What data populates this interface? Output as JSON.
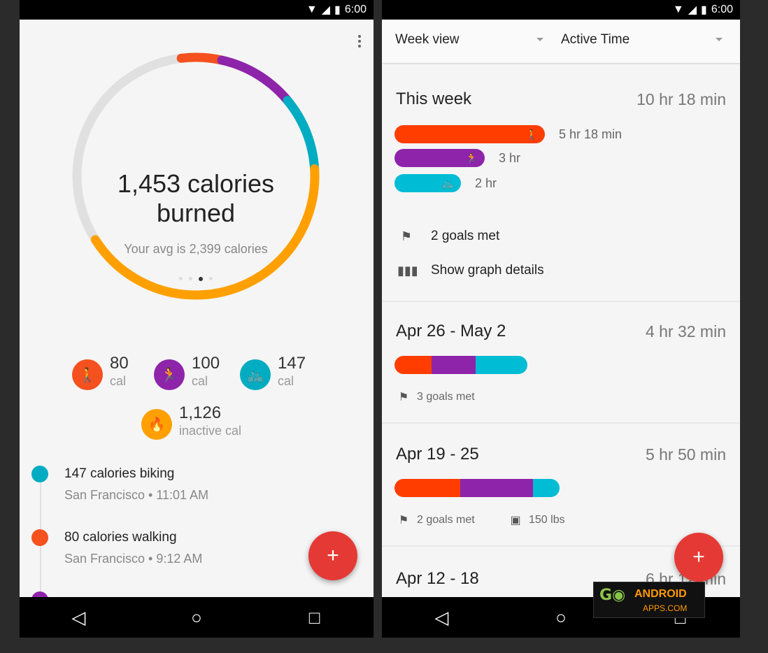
{
  "left": {
    "status_time": "6:00",
    "summary": {
      "calories_line1": "1,453 calories",
      "calories_line2": "burned",
      "avg": "Your avg is 2,399 calories"
    },
    "ring": {
      "segments": [
        {
          "name": "walking",
          "color": "#f4511e",
          "fraction": 0.055
        },
        {
          "name": "running",
          "color": "#8e24aa",
          "fraction": 0.105
        },
        {
          "name": "biking",
          "color": "#00acc1",
          "fraction": 0.1
        },
        {
          "name": "inactive",
          "color": "#ffa000",
          "fraction": 0.42
        },
        {
          "name": "remaining",
          "color": "#e0e0e0",
          "fraction": 0.32
        }
      ]
    },
    "stats": [
      {
        "value": "80",
        "unit": "cal",
        "icon": "walk-icon",
        "color": "#f4511e"
      },
      {
        "value": "100",
        "unit": "cal",
        "icon": "run-icon",
        "color": "#8e24aa"
      },
      {
        "value": "147",
        "unit": "cal",
        "icon": "bike-icon",
        "color": "#00acc1"
      },
      {
        "value": "1,126",
        "unit": "inactive cal",
        "icon": "flame-icon",
        "color": "#ffa000"
      }
    ],
    "timeline": [
      {
        "title": "147 calories biking",
        "sub": "San Francisco • 11:01 AM",
        "color": "#00acc1"
      },
      {
        "title": "80 calories walking",
        "sub": "San Francisco • 9:12 AM",
        "color": "#f4511e"
      }
    ],
    "fab_icon": "+"
  },
  "right": {
    "status_time": "6:00",
    "dropdowns": {
      "view": "Week view",
      "metric": "Active Time"
    },
    "this_week": {
      "title": "This week",
      "total": "10 hr 18 min",
      "bars": [
        {
          "label": "5 hr 18 min",
          "color": "#ff3d00",
          "fraction": 1.0,
          "icon": "walk-icon"
        },
        {
          "label": "3 hr",
          "color": "#8e24aa",
          "fraction": 0.6,
          "icon": "run-icon"
        },
        {
          "label": "2 hr",
          "color": "#00bcd4",
          "fraction": 0.44,
          "icon": "bike-icon"
        }
      ],
      "goals": "2 goals met",
      "graph_link": "Show graph details"
    },
    "weeks": [
      {
        "title": "Apr 26 - May 2",
        "total": "4 hr 32 min",
        "goals": "3 goals met",
        "weight": "",
        "segments": [
          {
            "color": "#ff3d00",
            "fraction": 0.28
          },
          {
            "color": "#8e24aa",
            "fraction": 0.33
          },
          {
            "color": "#00bcd4",
            "fraction": 0.39
          }
        ]
      },
      {
        "title": "Apr 19 - 25",
        "total": "5 hr 50 min",
        "goals": "2 goals met",
        "weight": "150 lbs",
        "segments": [
          {
            "color": "#ff3d00",
            "fraction": 0.4
          },
          {
            "color": "#8e24aa",
            "fraction": 0.44
          },
          {
            "color": "#00bcd4",
            "fraction": 0.16
          }
        ]
      },
      {
        "title": "Apr 12 - 18",
        "total": "6 hr 12 min",
        "goals": "",
        "weight": "",
        "segments": []
      }
    ],
    "fab_icon": "+"
  },
  "watermark": {
    "brand": "ANDROID",
    "domain": "APPS.COM"
  }
}
